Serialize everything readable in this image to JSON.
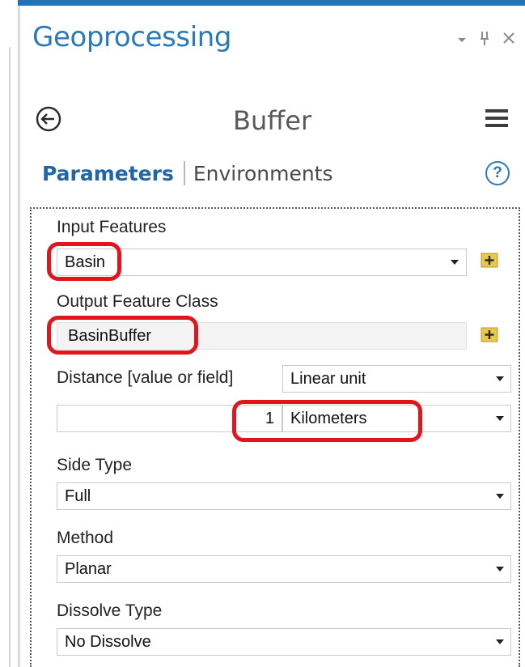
{
  "pane": {
    "title": "Geoprocessing",
    "controls": {
      "minimize_glyph": "▾",
      "pin_glyph": "ᚁ",
      "close_glyph": "✕"
    }
  },
  "tool": {
    "title": "Buffer",
    "back_icon": "back-circle-arrow-icon",
    "menu_icon": "hamburger-menu-icon"
  },
  "tabs": {
    "parameters": "Parameters",
    "environments": "Environments",
    "help_glyph": "?"
  },
  "params": {
    "input_features": {
      "label": "Input Features",
      "value": "Basin"
    },
    "output_feature_class": {
      "label": "Output Feature Class",
      "value": "BasinBuffer"
    },
    "distance": {
      "label": "Distance [value or field]",
      "type_value": "Linear unit",
      "amount": "1",
      "unit": "Kilometers"
    },
    "side_type": {
      "label": "Side Type",
      "value": "Full"
    },
    "method": {
      "label": "Method",
      "value": "Planar"
    },
    "dissolve_type": {
      "label": "Dissolve Type",
      "value": "No Dissolve"
    }
  },
  "colors": {
    "accent": "#2a7ab8",
    "highlight": "#e2141c",
    "folder": "#e8c84a"
  }
}
